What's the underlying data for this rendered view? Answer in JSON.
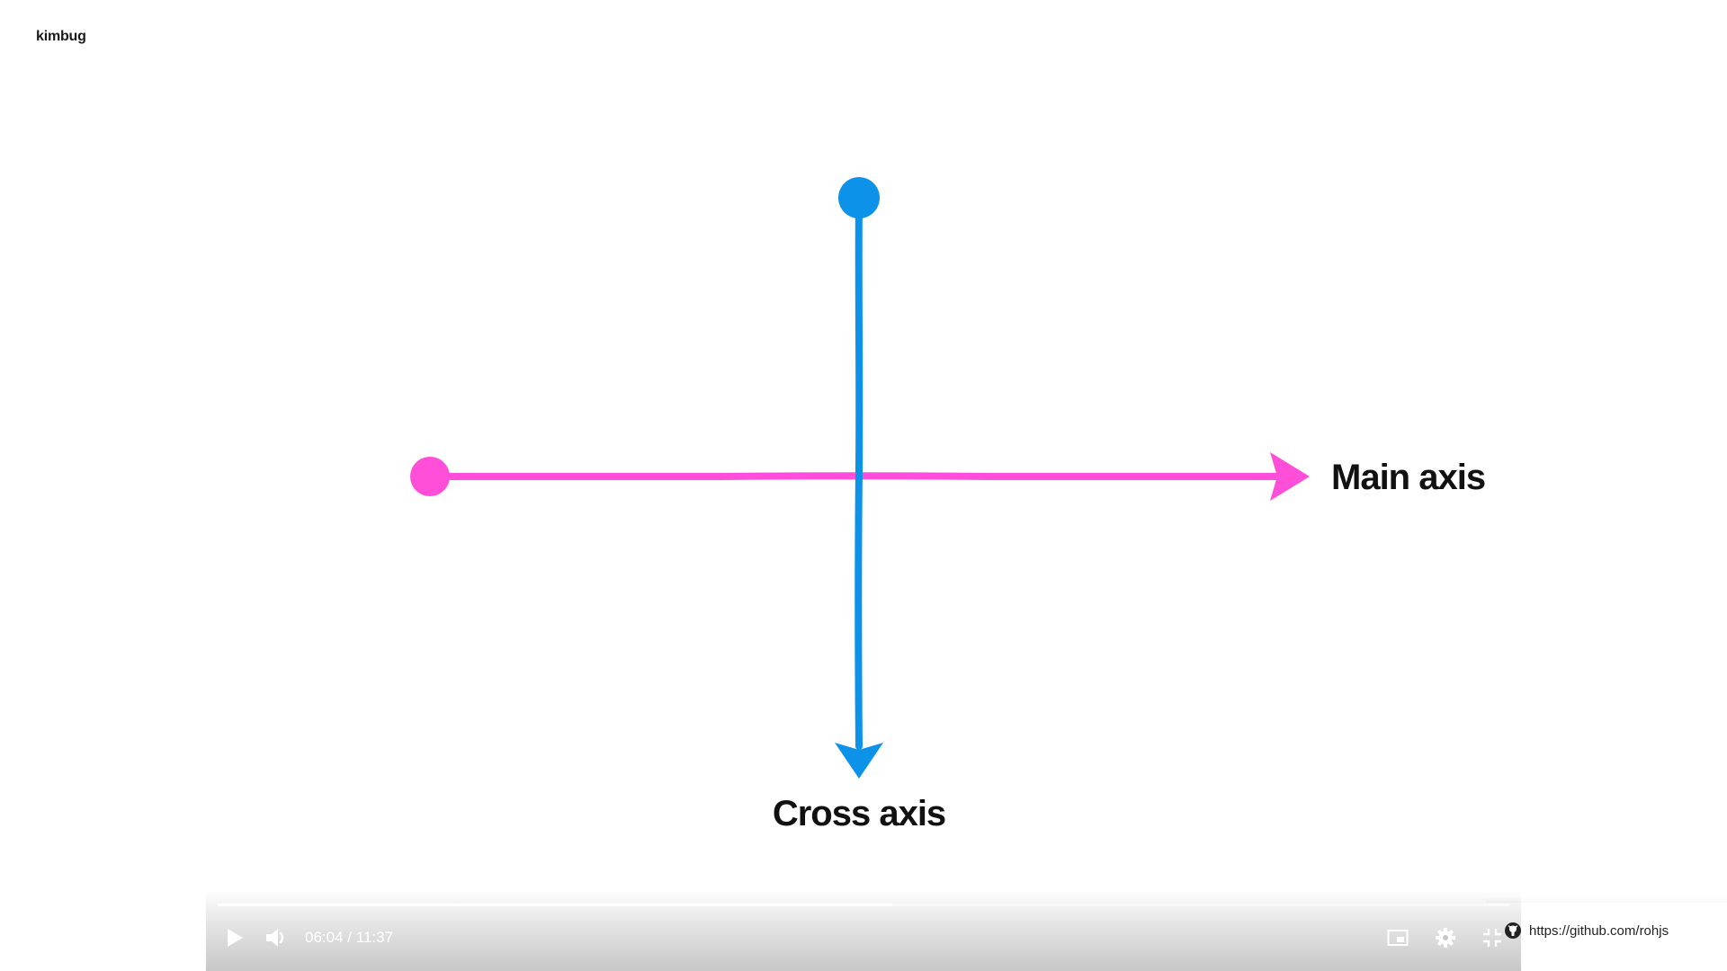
{
  "brand": {
    "name": "kimbug"
  },
  "diagram": {
    "main_axis_label": "Main axis",
    "cross_axis_label": "Cross axis",
    "colors": {
      "main_axis": "#ff4fd8",
      "cross_axis": "#0c92e8",
      "label": "#111111"
    }
  },
  "player": {
    "current_time": "06:04",
    "separator": "/",
    "duration": "11:37",
    "progress_fraction": 0.522,
    "icons": {
      "play": "play-icon",
      "volume": "volume-icon",
      "miniplayer": "miniplayer-icon",
      "settings": "gear-icon",
      "exit_fullscreen": "exit-fullscreen-icon"
    }
  },
  "overlay_link": {
    "icon": "github-icon",
    "text": "https://github.com/rohjs"
  }
}
